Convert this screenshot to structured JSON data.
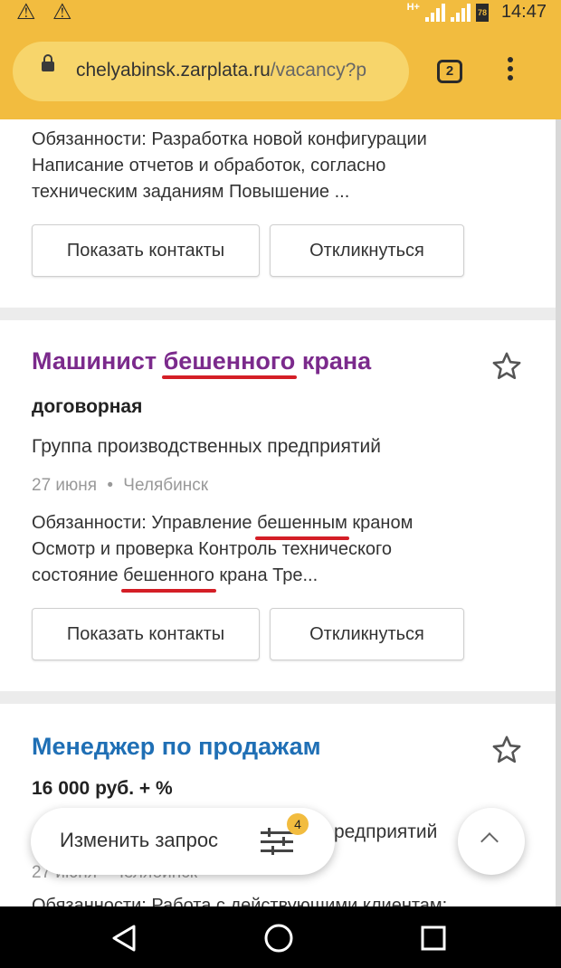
{
  "status_bar": {
    "warnings": [
      "⚠",
      "⚠"
    ],
    "network": "H+",
    "battery": "78",
    "time": "14:47"
  },
  "browser": {
    "url_domain": "chelyabinsk.zarplata.ru",
    "url_path": "/vacancy?p",
    "tab_count": "2"
  },
  "cards": [
    {
      "desc_lines": [
        "Обязанности: Разработка новой конфигурации",
        "Написание отчетов и обработок, согласно",
        "техническим заданиям Повышение ..."
      ],
      "show_contacts": "Показать контакты",
      "respond": "Откликнуться"
    },
    {
      "title_parts": [
        "Машинист ",
        "бешенного",
        " крана"
      ],
      "title_color": "#7b2a8c",
      "salary": "договорная",
      "company": "Группа производственных предприятий",
      "date": "27 июня",
      "city": "Челябинск",
      "desc_line1": [
        "Обязанности: Управление ",
        "бешенным",
        " краном"
      ],
      "desc_line2": "Осмотр и проверка Контроль технического",
      "desc_line3": [
        "состояние ",
        "бешенного",
        " крана Тре..."
      ],
      "show_contacts": "Показать контакты",
      "respond": "Откликнуться"
    },
    {
      "title": "Менеджер по продажам",
      "title_color": "#1f6fb5",
      "salary": "16 000 руб. + %",
      "company_peek": "редприятий",
      "date_peek": "27 июня • Челябинск",
      "desc_peek": "Обязанности: Работа с действующими клиентам:"
    }
  ],
  "floating": {
    "change_query": "Изменить запрос",
    "filter_badge": "4"
  },
  "icons": {
    "star": "star-outline-icon",
    "filter": "sliders-icon",
    "up": "chevron-up-icon"
  }
}
